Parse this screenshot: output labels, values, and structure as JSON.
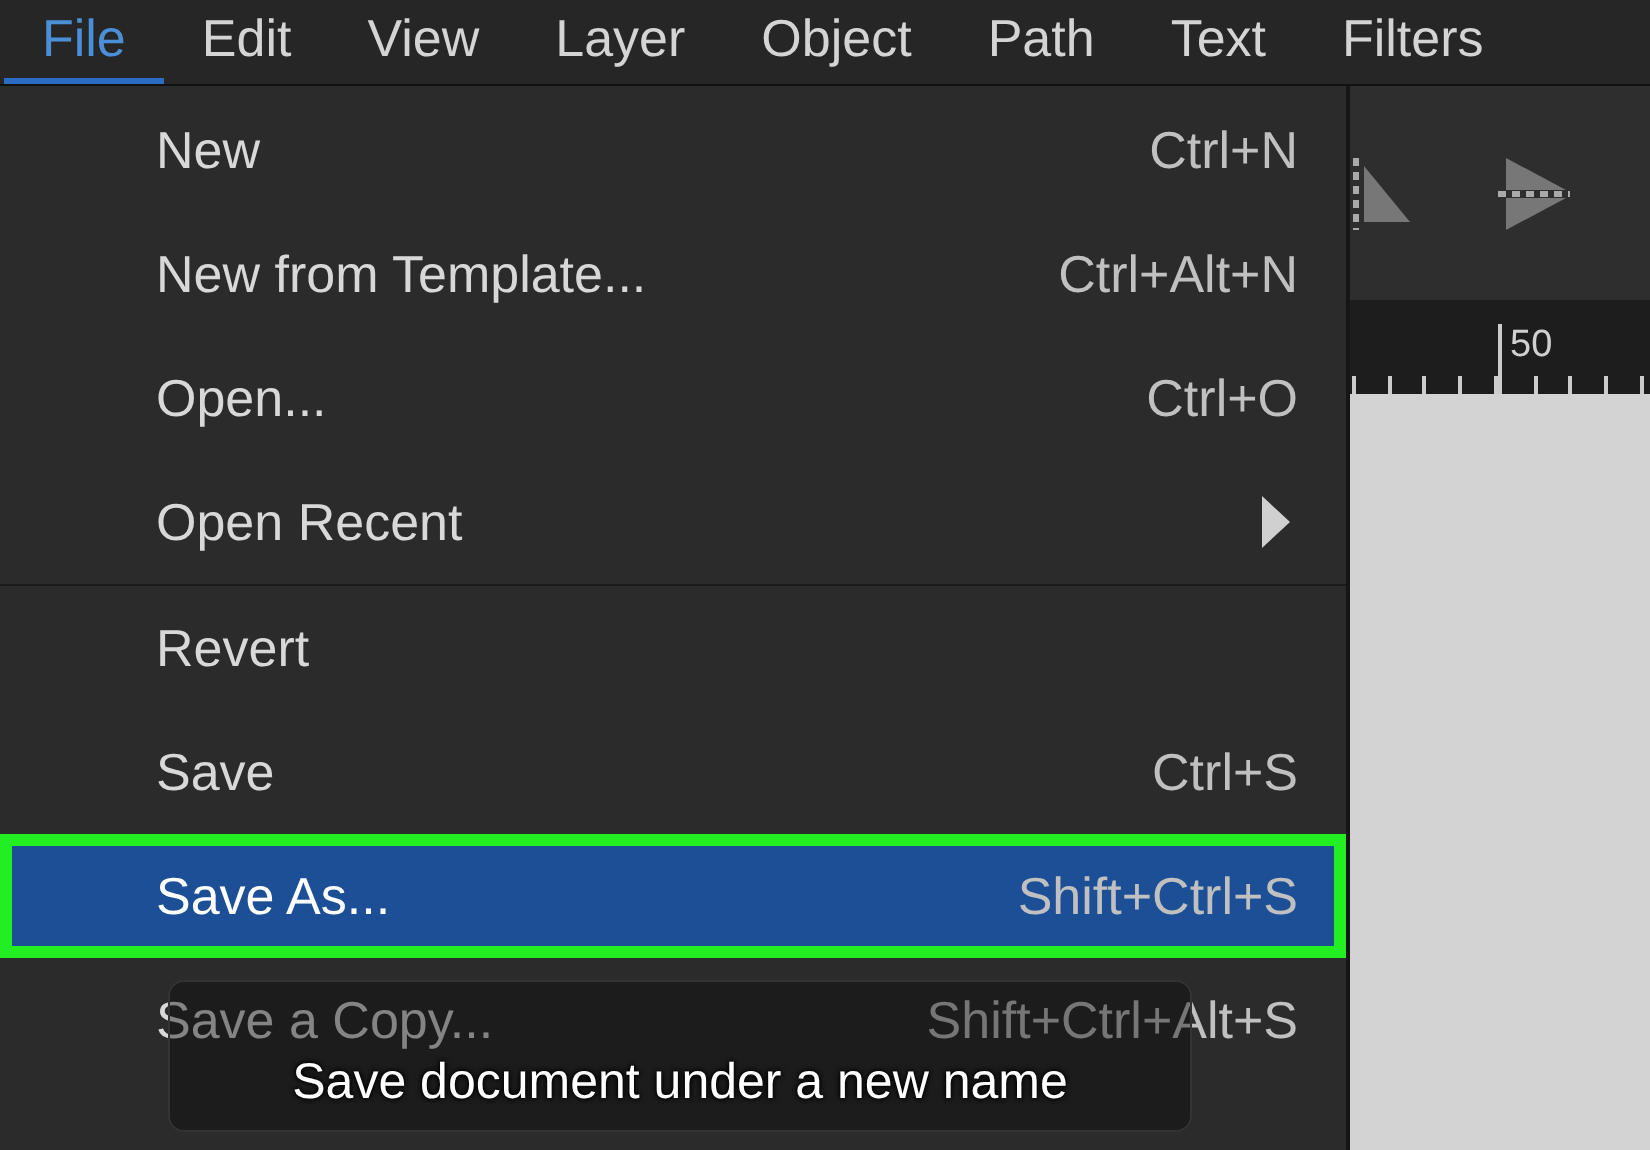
{
  "menu_bar": [
    {
      "label": "File",
      "selected": true
    },
    {
      "label": "Edit",
      "selected": false
    },
    {
      "label": "View",
      "selected": false
    },
    {
      "label": "Layer",
      "selected": false
    },
    {
      "label": "Object",
      "selected": false
    },
    {
      "label": "Path",
      "selected": false
    },
    {
      "label": "Text",
      "selected": false
    },
    {
      "label": "Filters",
      "selected": false
    }
  ],
  "file_menu": [
    {
      "label": "New",
      "shortcut": "Ctrl+N",
      "kind": "item",
      "selected": false
    },
    {
      "label": "New from Template...",
      "shortcut": "Ctrl+Alt+N",
      "kind": "item",
      "selected": false
    },
    {
      "label": "Open...",
      "shortcut": "Ctrl+O",
      "kind": "item",
      "selected": false
    },
    {
      "label": "Open Recent",
      "kind": "submenu",
      "selected": false
    },
    {
      "kind": "separator"
    },
    {
      "label": "Revert",
      "kind": "item",
      "selected": false
    },
    {
      "label": "Save",
      "shortcut": "Ctrl+S",
      "kind": "item",
      "selected": false
    },
    {
      "label": "Save As...",
      "shortcut": "Shift+Ctrl+S",
      "kind": "item",
      "selected": true
    },
    {
      "label": "Save a Copy...",
      "shortcut": "Shift+Ctrl+Alt+S",
      "kind": "item",
      "selected": false
    }
  ],
  "tooltip": "Save document under a new name",
  "ruler": {
    "label": "50"
  }
}
